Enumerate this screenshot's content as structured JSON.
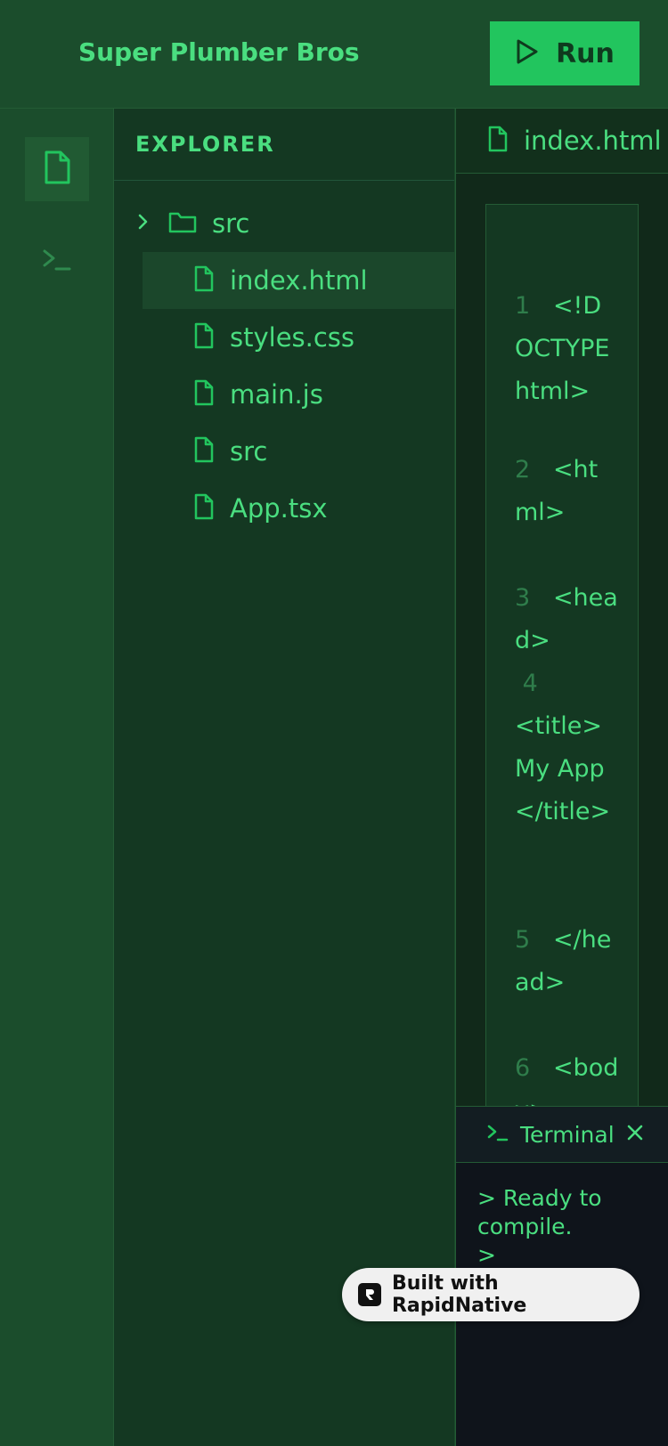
{
  "header": {
    "title": "Super Plumber Bros",
    "run_label": "Run"
  },
  "activity_bar": {
    "items": [
      {
        "icon": "file-icon",
        "active": true
      },
      {
        "icon": "terminal-icon",
        "active": false
      }
    ]
  },
  "explorer": {
    "title": "EXPLORER",
    "folder": {
      "name": "src",
      "icon": "folder-icon",
      "expanded": false
    },
    "files": [
      {
        "name": "index.html",
        "selected": true
      },
      {
        "name": "styles.css",
        "selected": false
      },
      {
        "name": "main.js",
        "selected": false
      },
      {
        "name": "src",
        "selected": false
      },
      {
        "name": "App.tsx",
        "selected": false
      }
    ]
  },
  "editor": {
    "active_tab": "index.html",
    "unsaved": true,
    "lines": [
      {
        "num": "1",
        "text": "<!DOCTYPE html>"
      },
      {
        "num": "2",
        "text": "<html>"
      },
      {
        "num": "3",
        "text": "<head>"
      },
      {
        "num": "4",
        "text": "<title>My App</title>"
      },
      {
        "num": "5",
        "text": "</head>"
      },
      {
        "num": "6",
        "text": "<body>"
      }
    ]
  },
  "terminal": {
    "title": "Terminal",
    "output": [
      "> Ready to compile.",
      ">"
    ]
  },
  "badge": {
    "text": "Built with RapidNative"
  },
  "colors": {
    "accent": "#22c55e",
    "text": "#4ade80",
    "header_bg": "#1b4d2c",
    "explorer_bg": "#143822",
    "terminal_bg": "#0f141b"
  }
}
